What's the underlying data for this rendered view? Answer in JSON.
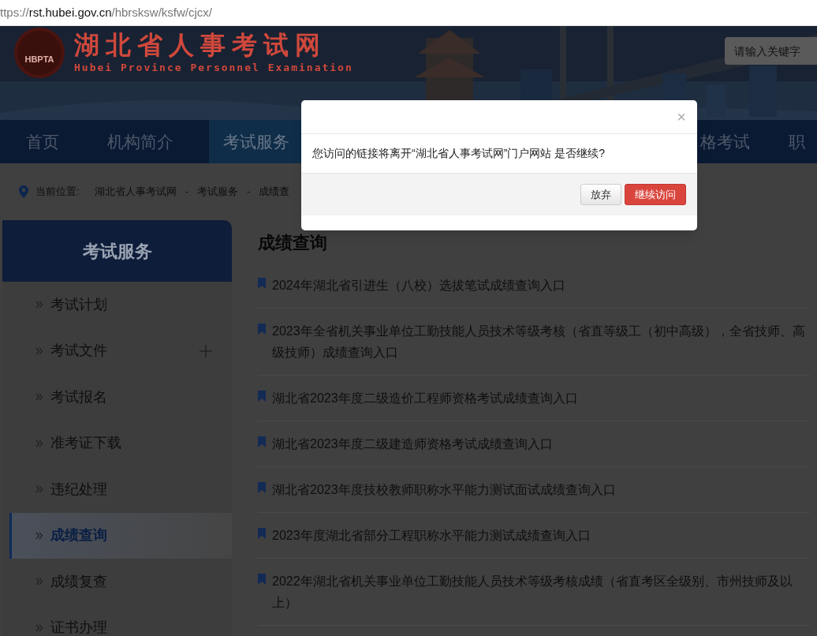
{
  "address_bar": {
    "url_parts": [
      {
        "text": "ttps://",
        "kind": "dim"
      },
      {
        "text": "rst.hubei.gov.cn",
        "kind": "host"
      },
      {
        "text": "/hbrsksw/ksfw/cjcx/",
        "kind": "dim"
      }
    ]
  },
  "header": {
    "logo_badge": "HBPTA",
    "title": "湖北省人事考试网",
    "subtitle": "Hubei Province Personnel Examination",
    "search": {
      "placeholder": "请输入关键字"
    }
  },
  "nav": [
    {
      "label": "首页",
      "selected": false
    },
    {
      "label": "机构简介",
      "selected": false
    },
    {
      "label": "考试服务",
      "selected": true
    },
    {
      "label": "格考试",
      "selected": false
    },
    {
      "label": "职",
      "selected": false
    }
  ],
  "breadcrumb": {
    "label": "当前位置:",
    "separator": "-",
    "items": [
      "湖北省人事考试网",
      "考试服务",
      "成绩查"
    ]
  },
  "sidebar": {
    "title": "考试服务",
    "items": [
      {
        "label": "考试计划",
        "selected": false,
        "expandable": false
      },
      {
        "label": "考试文件",
        "selected": false,
        "expandable": true
      },
      {
        "label": "考试报名",
        "selected": false,
        "expandable": false
      },
      {
        "label": "准考证下载",
        "selected": false,
        "expandable": false
      },
      {
        "label": "违纪处理",
        "selected": false,
        "expandable": false
      },
      {
        "label": "成绩查询",
        "selected": true,
        "expandable": false
      },
      {
        "label": "成绩复查",
        "selected": false,
        "expandable": false
      },
      {
        "label": "证书办理",
        "selected": false,
        "expandable": false
      }
    ]
  },
  "content": {
    "title": "成绩查询",
    "links": [
      "2024年湖北省引进生（八校）选拔笔试成绩查询入口",
      "2023年全省机关事业单位工勤技能人员技术等级考核（省直等级工（初中高级），全省技师、高级技师）成绩查询入口",
      "湖北省2023年度二级造价工程师资格考试成绩查询入口",
      "湖北省2023年度二级建造师资格考试成绩查询入口",
      "湖北省2023年度技校教师职称水平能力测试面试成绩查询入口",
      "2023年度湖北省部分工程职称水平能力测试成绩查询入口",
      "2022年湖北省机关事业单位工勤技能人员技术等级考核成绩（省直考区全级别、市州技师及以上）"
    ]
  },
  "dialog": {
    "close": "×",
    "message": "您访问的链接将离开“湖北省人事考试网”门户网站 是否继续?",
    "buttons": [
      {
        "label": "放弃",
        "kind": "default"
      },
      {
        "label": "继续访问",
        "kind": "primary"
      }
    ]
  }
}
